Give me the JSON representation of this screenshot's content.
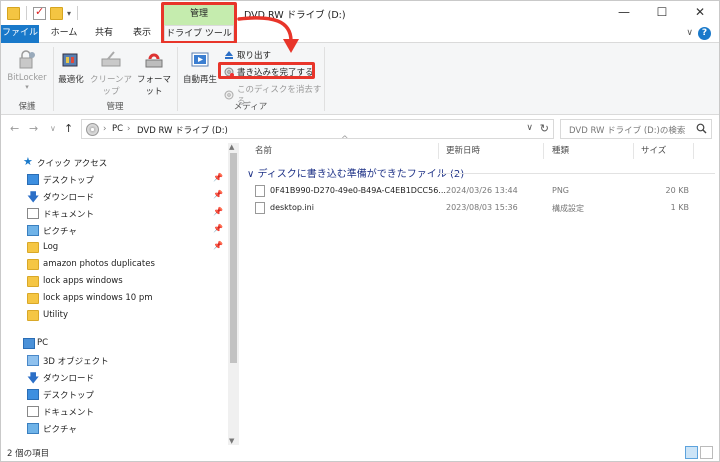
{
  "titlebar": {
    "title": "DVD RW ドライブ (D:)",
    "contextual_group": "管理",
    "minimize": "—",
    "maximize": "☐",
    "close": "✕",
    "qat_dropdown": "▾"
  },
  "tabs": {
    "file": "ファイル",
    "home": "ホーム",
    "share": "共有",
    "view": "表示",
    "drive_tools": "ドライブ ツール",
    "help": "?",
    "collapse": "∨"
  },
  "ribbon": {
    "protect_group": {
      "label": "保護",
      "bitlocker": "BitLocker"
    },
    "manage_group": {
      "label": "管理",
      "optimize": "最適化",
      "cleanup": "クリーンアップ",
      "format": "フォーマット"
    },
    "media_group": {
      "label": "メディア",
      "autoplay": "自動再生",
      "eject": "取り出す",
      "finish_burning": "書き込みを完了する",
      "erase_disc": "このディスクを消去する"
    }
  },
  "address": {
    "crumbs": [
      "PC",
      "DVD RW ドライブ (D:)"
    ],
    "search_placeholder": "DVD RW ドライブ (D:)の検索"
  },
  "navpane": {
    "quick_access": "クイック アクセス",
    "pinned": [
      {
        "label": "デスクトップ",
        "icon": "desktop-icon",
        "pinned": true
      },
      {
        "label": "ダウンロード",
        "icon": "download-arrow-icon",
        "pinned": true
      },
      {
        "label": "ドキュメント",
        "icon": "documents-icon",
        "pinned": true
      },
      {
        "label": "ピクチャ",
        "icon": "pictures-icon",
        "pinned": true
      },
      {
        "label": "Log",
        "icon": "folder-icon",
        "pinned": true
      },
      {
        "label": "amazon photos duplicates",
        "icon": "folder-icon",
        "pinned": false
      },
      {
        "label": "lock apps windows",
        "icon": "folder-icon",
        "pinned": false
      },
      {
        "label": "lock apps windows 10 pm",
        "icon": "folder-icon",
        "pinned": false
      },
      {
        "label": "Utility",
        "icon": "folder-icon",
        "pinned": false
      }
    ],
    "pc": "PC",
    "pc_children": [
      {
        "label": "3D オブジェクト",
        "icon": "3d-objects-icon"
      },
      {
        "label": "ダウンロード",
        "icon": "download-arrow-icon"
      },
      {
        "label": "デスクトップ",
        "icon": "desktop-icon"
      },
      {
        "label": "ドキュメント",
        "icon": "documents-icon"
      },
      {
        "label": "ピクチャ",
        "icon": "pictures-icon"
      }
    ]
  },
  "columns": {
    "name": "名前",
    "modified": "更新日時",
    "type": "種類",
    "size": "サイズ"
  },
  "group_header": "ディスクに書き込む準備ができたファイル (2)",
  "files": [
    {
      "name": "0F41B990-D270-49e0-B49A-C4EB1DCC56...",
      "modified": "2024/03/26 13:44",
      "type": "PNG",
      "size": "20 KB"
    },
    {
      "name": "desktop.ini",
      "modified": "2023/08/03 15:36",
      "type": "構成設定",
      "size": "1 KB"
    }
  ],
  "status": {
    "item_count": "2 個の項目"
  },
  "colors": {
    "accent": "#1979ca",
    "highlight_red": "#e8352a",
    "contextual_green": "#c5ecae",
    "group_header": "#1e3287"
  }
}
